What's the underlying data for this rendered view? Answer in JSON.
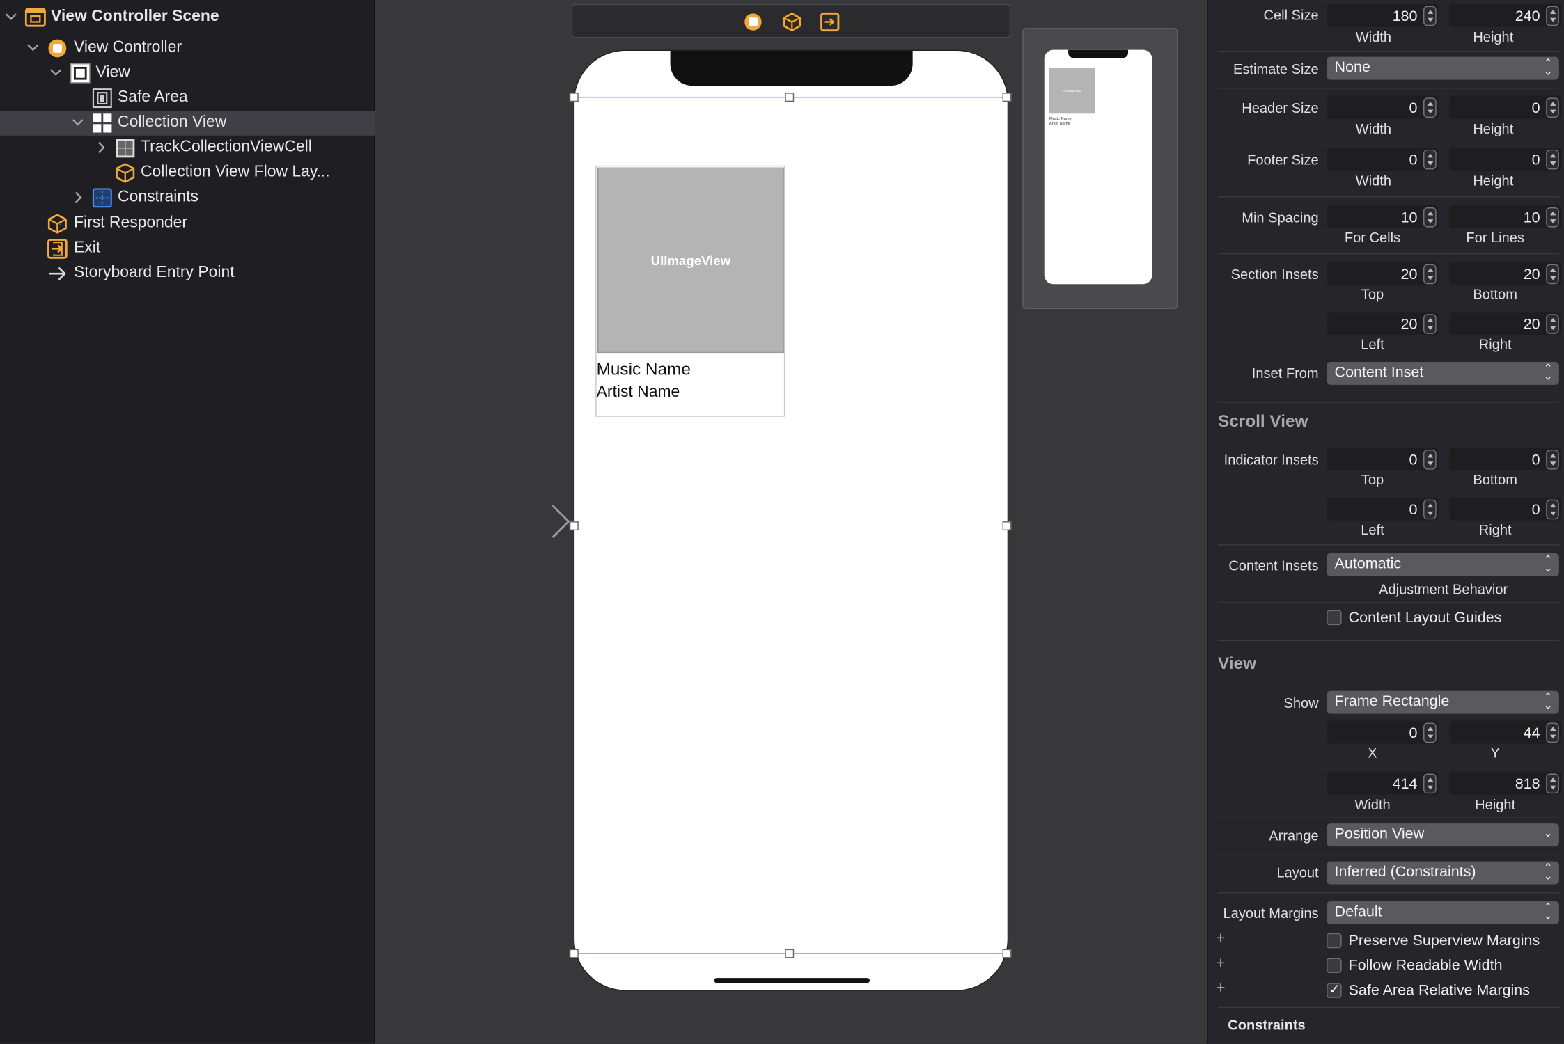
{
  "outline": {
    "items": [
      {
        "label": "View Controller Scene",
        "icon": "scene-icon",
        "expanded": true
      },
      {
        "label": "View Controller",
        "icon": "view-controller-icon",
        "expanded": true
      },
      {
        "label": "View",
        "icon": "view-icon",
        "expanded": true
      },
      {
        "label": "Safe Area",
        "icon": "safe-area-icon"
      },
      {
        "label": "Collection View",
        "icon": "collection-view-icon",
        "expanded": true,
        "selected": true
      },
      {
        "label": "TrackCollectionViewCell",
        "icon": "collection-cell-icon",
        "expanded": false
      },
      {
        "label": "Collection View Flow Lay...",
        "icon": "flow-layout-cube-icon"
      },
      {
        "label": "Constraints",
        "icon": "constraints-icon",
        "expanded": false
      },
      {
        "label": "First Responder",
        "icon": "first-responder-cube-icon"
      },
      {
        "label": "Exit",
        "icon": "exit-icon"
      },
      {
        "label": "Storyboard Entry Point",
        "icon": "arrow-right-icon"
      }
    ]
  },
  "canvas": {
    "scene_bar_icons": [
      "view-controller-icon",
      "first-responder-cube-icon",
      "exit-icon"
    ],
    "cell": {
      "image_label": "UIImageView",
      "music_name": "Music Name",
      "artist_name": "Artist Name"
    },
    "minimap": {
      "image_label": "UIImageView",
      "music_name": "Music Name",
      "artist_name": "Artist Name"
    }
  },
  "inspector": {
    "cell_size": {
      "label": "Cell Size",
      "width": "180",
      "height": "240",
      "width_label": "Width",
      "height_label": "Height"
    },
    "estimate_size": {
      "label": "Estimate Size",
      "value": "None"
    },
    "header_size": {
      "label": "Header Size",
      "width": "0",
      "height": "0",
      "width_label": "Width",
      "height_label": "Height"
    },
    "footer_size": {
      "label": "Footer Size",
      "width": "0",
      "height": "0",
      "width_label": "Width",
      "height_label": "Height"
    },
    "min_spacing": {
      "label": "Min Spacing",
      "cells": "10",
      "lines": "10",
      "cells_label": "For Cells",
      "lines_label": "For Lines"
    },
    "section_insets": {
      "label": "Section Insets",
      "top": "20",
      "bottom": "20",
      "left": "20",
      "right": "20",
      "top_label": "Top",
      "bottom_label": "Bottom",
      "left_label": "Left",
      "right_label": "Right"
    },
    "inset_from": {
      "label": "Inset From",
      "value": "Content Inset"
    },
    "scroll_view": {
      "header": "Scroll View",
      "indicator_insets": {
        "label": "Indicator Insets",
        "top": "0",
        "bottom": "0",
        "left": "0",
        "right": "0",
        "top_label": "Top",
        "bottom_label": "Bottom",
        "left_label": "Left",
        "right_label": "Right"
      },
      "content_insets": {
        "label": "Content Insets",
        "value": "Automatic",
        "sub": "Adjustment Behavior"
      },
      "content_layout_guides": {
        "label": "Content Layout Guides",
        "checked": false
      }
    },
    "view": {
      "header": "View",
      "show": {
        "label": "Show",
        "value": "Frame Rectangle"
      },
      "x": "0",
      "y": "44",
      "x_label": "X",
      "y_label": "Y",
      "width": "414",
      "height": "818",
      "width_label": "Width",
      "height_label": "Height",
      "arrange": {
        "label": "Arrange",
        "value": "Position View"
      },
      "layout": {
        "label": "Layout",
        "value": "Inferred (Constraints)"
      },
      "layout_margins": {
        "label": "Layout Margins",
        "value": "Default"
      },
      "preserve_superview_margins": {
        "label": "Preserve Superview Margins",
        "checked": false
      },
      "follow_readable_width": {
        "label": "Follow Readable Width",
        "checked": false
      },
      "safe_area_relative_margins": {
        "label": "Safe Area Relative Margins",
        "checked": true
      }
    },
    "constraints_header": "Constraints"
  },
  "colors": {
    "accent_orange": "#f2a93b",
    "selection_blue": "#5b85c8",
    "icon_blue": "#4a8fe8"
  }
}
